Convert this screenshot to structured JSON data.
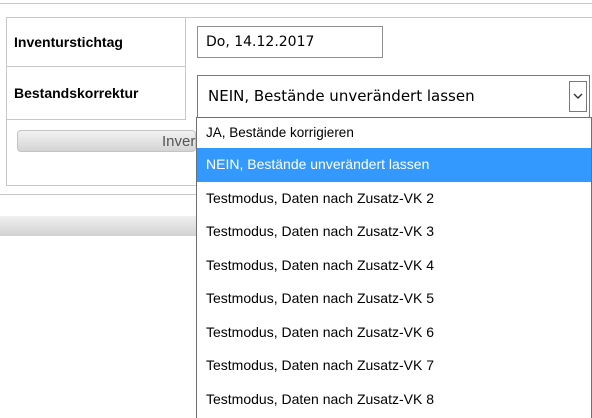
{
  "form": {
    "inventory_date_label": "Inventurstichtag",
    "inventory_date_value": "Do, 14.12.2017",
    "stock_correction_label": "Bestandskorrektur",
    "stock_correction_selected": "NEIN, Bestände unverändert lassen"
  },
  "button": {
    "partial_label": "Inver"
  },
  "dropdown": {
    "options": [
      "JA, Bestände korrigieren",
      "NEIN, Bestände unverändert lassen",
      "Testmodus, Daten nach Zusatz-VK 2",
      "Testmodus, Daten nach Zusatz-VK 3",
      "Testmodus, Daten nach Zusatz-VK 4",
      "Testmodus, Daten nach Zusatz-VK 5",
      "Testmodus, Daten nach Zusatz-VK 6",
      "Testmodus, Daten nach Zusatz-VK 7",
      "Testmodus, Daten nach Zusatz-VK 8"
    ],
    "selected_index": 1
  },
  "icons": {
    "select_arrow": "chevron-down-icon"
  },
  "colors": {
    "highlight": "#3399ff",
    "border": "#c8c8c8"
  }
}
